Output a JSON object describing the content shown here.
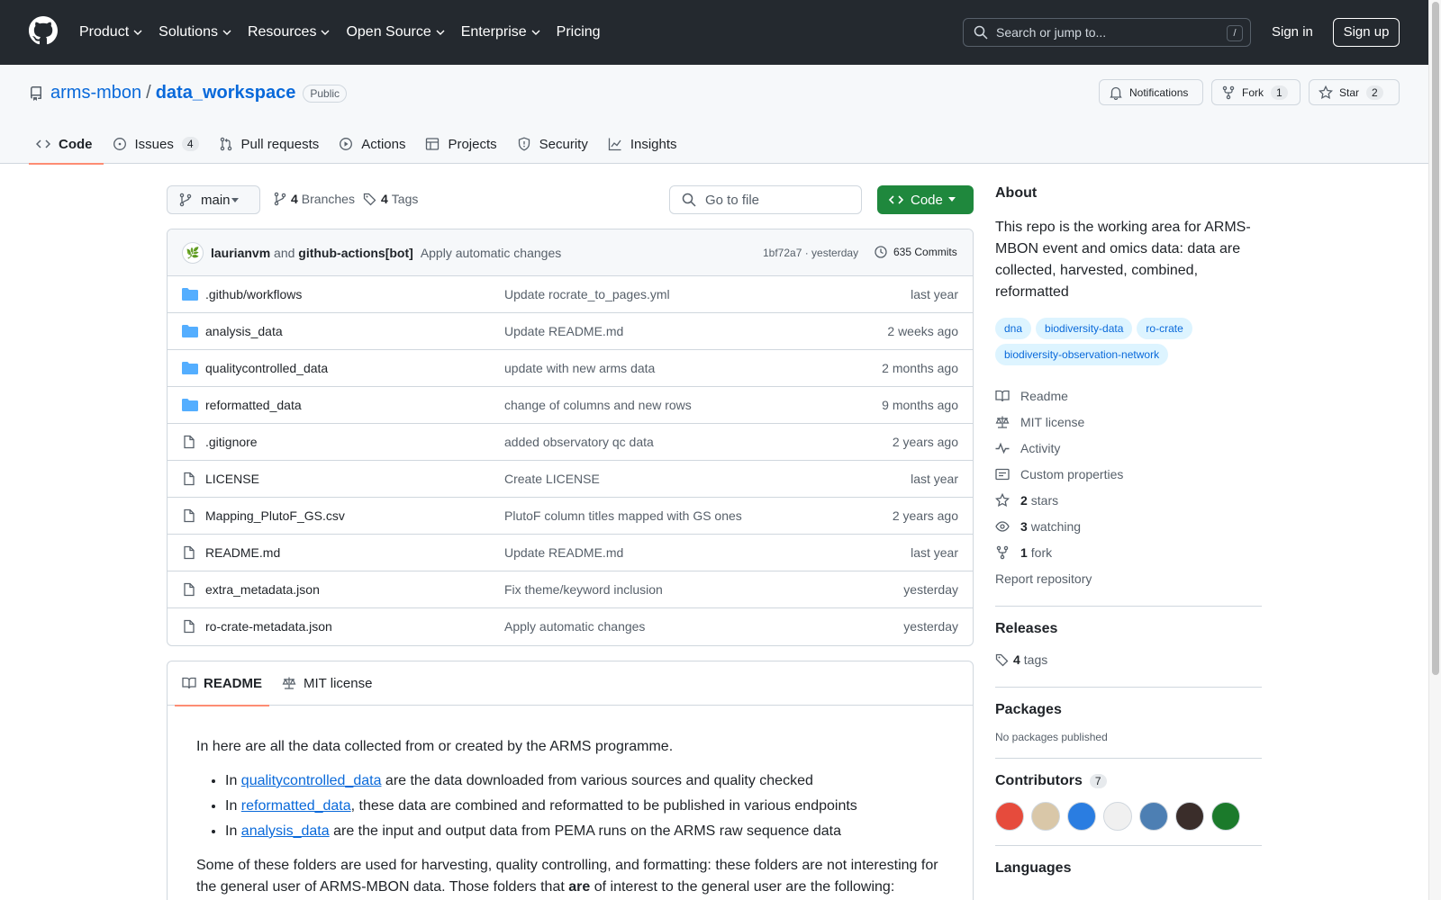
{
  "header": {
    "nav": [
      "Product",
      "Solutions",
      "Resources",
      "Open Source",
      "Enterprise",
      "Pricing"
    ],
    "nav_has_caret": [
      true,
      true,
      true,
      true,
      true,
      false
    ],
    "search_placeholder": "Search or jump to...",
    "search_shortcut": "/",
    "sign_in": "Sign in",
    "sign_up": "Sign up"
  },
  "repo": {
    "owner": "arms-mbon",
    "separator": "/",
    "name": "data_workspace",
    "visibility": "Public",
    "notifications_label": "Notifications",
    "fork_label": "Fork",
    "fork_count": "1",
    "star_label": "Star",
    "star_count": "2"
  },
  "tabs": [
    {
      "label": "Code",
      "icon": "code-icon",
      "count": ""
    },
    {
      "label": "Issues",
      "icon": "issue-icon",
      "count": "4"
    },
    {
      "label": "Pull requests",
      "icon": "pull-request-icon",
      "count": ""
    },
    {
      "label": "Actions",
      "icon": "play-icon",
      "count": ""
    },
    {
      "label": "Projects",
      "icon": "table-icon",
      "count": ""
    },
    {
      "label": "Security",
      "icon": "shield-icon",
      "count": ""
    },
    {
      "label": "Insights",
      "icon": "graph-icon",
      "count": ""
    }
  ],
  "toolbar": {
    "branch": "main",
    "branches_count": "4",
    "branches_label": "Branches",
    "tags_count": "4",
    "tags_label": "Tags",
    "goto_placeholder": "Go to file",
    "code_button": "Code"
  },
  "commit": {
    "author1": "laurianvm",
    "and": "and",
    "author2": "github-actions[bot]",
    "message": "Apply automatic changes",
    "sha_time": "1bf72a7 · yesterday",
    "commits": "635 Commits"
  },
  "files": [
    {
      "type": "dir",
      "name": ".github/workflows",
      "message": "Update rocrate_to_pages.yml",
      "time": "last year"
    },
    {
      "type": "dir",
      "name": "analysis_data",
      "message": "Update README.md",
      "time": "2 weeks ago"
    },
    {
      "type": "dir",
      "name": "qualitycontrolled_data",
      "message": "update with new arms data",
      "time": "2 months ago"
    },
    {
      "type": "dir",
      "name": "reformatted_data",
      "message": "change of columns and new rows",
      "time": "9 months ago"
    },
    {
      "type": "file",
      "name": ".gitignore",
      "message": "added observatory qc data",
      "time": "2 years ago"
    },
    {
      "type": "file",
      "name": "LICENSE",
      "message": "Create LICENSE",
      "time": "last year"
    },
    {
      "type": "file",
      "name": "Mapping_PlutoF_GS.csv",
      "message": "PlutoF column titles mapped with GS ones",
      "time": "2 years ago"
    },
    {
      "type": "file",
      "name": "README.md",
      "message": "Update README.md",
      "time": "last year"
    },
    {
      "type": "file",
      "name": "extra_metadata.json",
      "message": "Fix theme/keyword inclusion",
      "time": "yesterday"
    },
    {
      "type": "file",
      "name": "ro-crate-metadata.json",
      "message": "Apply automatic changes",
      "time": "yesterday"
    }
  ],
  "readme": {
    "tab_readme": "README",
    "tab_license": "MIT license",
    "intro": "In here are all the data collected from or created by the ARMS programme.",
    "bullets": [
      {
        "pre": "In ",
        "link": "qualitycontrolled_data",
        "post": " are the data downloaded from various sources and quality checked"
      },
      {
        "pre": "In ",
        "link": "reformatted_data",
        "post": ", these data are combined and reformatted to be published in various endpoints"
      },
      {
        "pre": "In ",
        "link": "analysis_data",
        "post": " are the input and output data from PEMA runs on the ARMS raw sequence data"
      }
    ],
    "para2_a": "Some of these folders are used for harvesting, quality controlling, and formatting: these folders are not interesting for the general user of ARMS-MBON data. Those folders that ",
    "para2_b": "are",
    "para2_c": " of interest to the general user are the following:"
  },
  "about": {
    "title": "About",
    "description": "This repo is the working area for ARMS-MBON event and omics data: data are collected, harvested, combined, reformatted",
    "topics": [
      "dna",
      "biodiversity-data",
      "ro-crate",
      "biodiversity-observation-network"
    ],
    "meta": [
      {
        "icon": "book-icon",
        "bold": "",
        "label": "Readme"
      },
      {
        "icon": "law-icon",
        "bold": "",
        "label": "MIT license"
      },
      {
        "icon": "pulse-icon",
        "bold": "",
        "label": "Activity"
      },
      {
        "icon": "note-icon",
        "bold": "",
        "label": "Custom properties"
      },
      {
        "icon": "star-icon",
        "bold": "2",
        "label": "stars"
      },
      {
        "icon": "eye-icon",
        "bold": "3",
        "label": "watching"
      },
      {
        "icon": "fork-icon",
        "bold": "1",
        "label": "fork"
      }
    ],
    "report": "Report repository"
  },
  "releases": {
    "title": "Releases",
    "tags_count": "4",
    "tags_label": "tags"
  },
  "packages": {
    "title": "Packages",
    "none": "No packages published"
  },
  "contributors": {
    "title": "Contributors",
    "count": "7",
    "avatar_colors": [
      "#e64b3c",
      "#d9c7a8",
      "#2a7de1",
      "#f0f0f0",
      "#4d7fb3",
      "#3a2d2a",
      "#1b7a2b"
    ]
  },
  "languages": {
    "title": "Languages"
  },
  "colors": {
    "header_bg": "#24292f",
    "link": "#0969da",
    "green": "#1f883d",
    "tab_underline": "#fd8c73"
  }
}
